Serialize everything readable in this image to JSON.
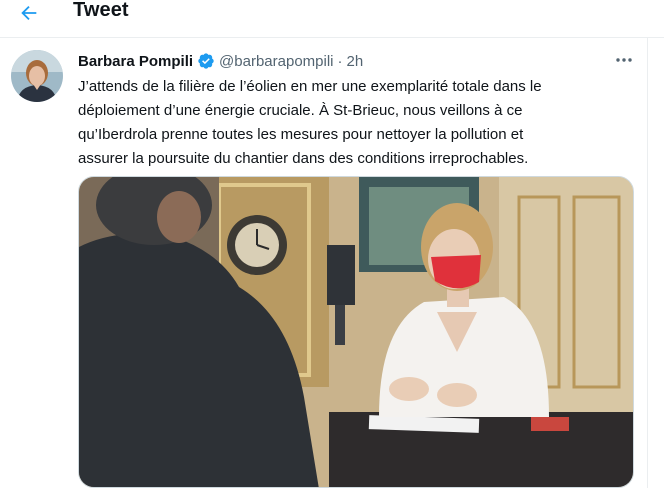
{
  "header": {
    "title": "Tweet"
  },
  "tweet": {
    "author_name": "Barbara Pompili",
    "handle": "@barbarapompili",
    "separator": "·",
    "time": "2h",
    "text_lines": [
      "J’attends de la filière de l’éolien en mer  une exemplarité totale dans le",
      "déploiement d’une énergie cruciale. À St-Brieuc, nous veillons à ce",
      "qu’Iberdrola prenne toutes les mesures pour nettoyer la pollution et",
      "assurer la poursuite du chantier dans des conditions irreprochables."
    ]
  },
  "icons": {
    "back": "arrow-left-icon",
    "verified": "verified-badge-icon",
    "more": "more-horizontal-icon"
  },
  "colors": {
    "accent": "#1d9bf0",
    "text_primary": "#0f1419",
    "text_secondary": "#536471",
    "divider": "#ebeef0"
  }
}
